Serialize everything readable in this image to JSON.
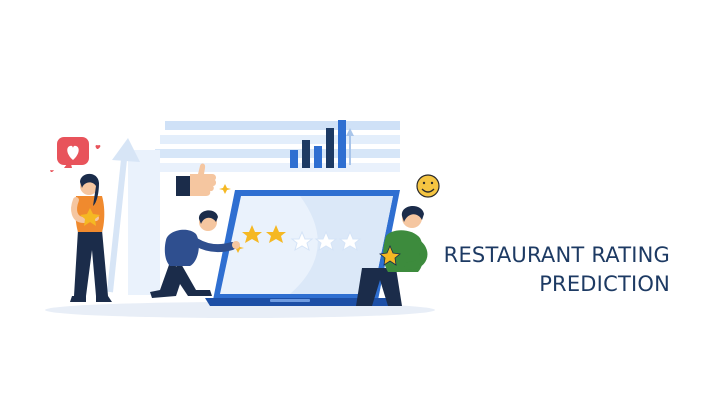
{
  "title": {
    "line1": "RESTAURANT RATING",
    "line2": "PREDICTION"
  },
  "illustration": {
    "rating_stars_filled": 2,
    "rating_stars_total": 5,
    "icons": [
      "heart-icon",
      "thumbs-up-icon",
      "smiley-icon",
      "bar-chart-icon",
      "star-icon",
      "laptop-icon"
    ]
  },
  "colors": {
    "title": "#1d3a63",
    "primary_blue": "#2f6fd1",
    "light_blue": "#cfe1f7",
    "star_gold": "#f5b823",
    "heart_red": "#e8535b",
    "green_shirt": "#3d8b3d",
    "orange_shirt": "#f08a2e",
    "navy": "#1b2c4a"
  }
}
